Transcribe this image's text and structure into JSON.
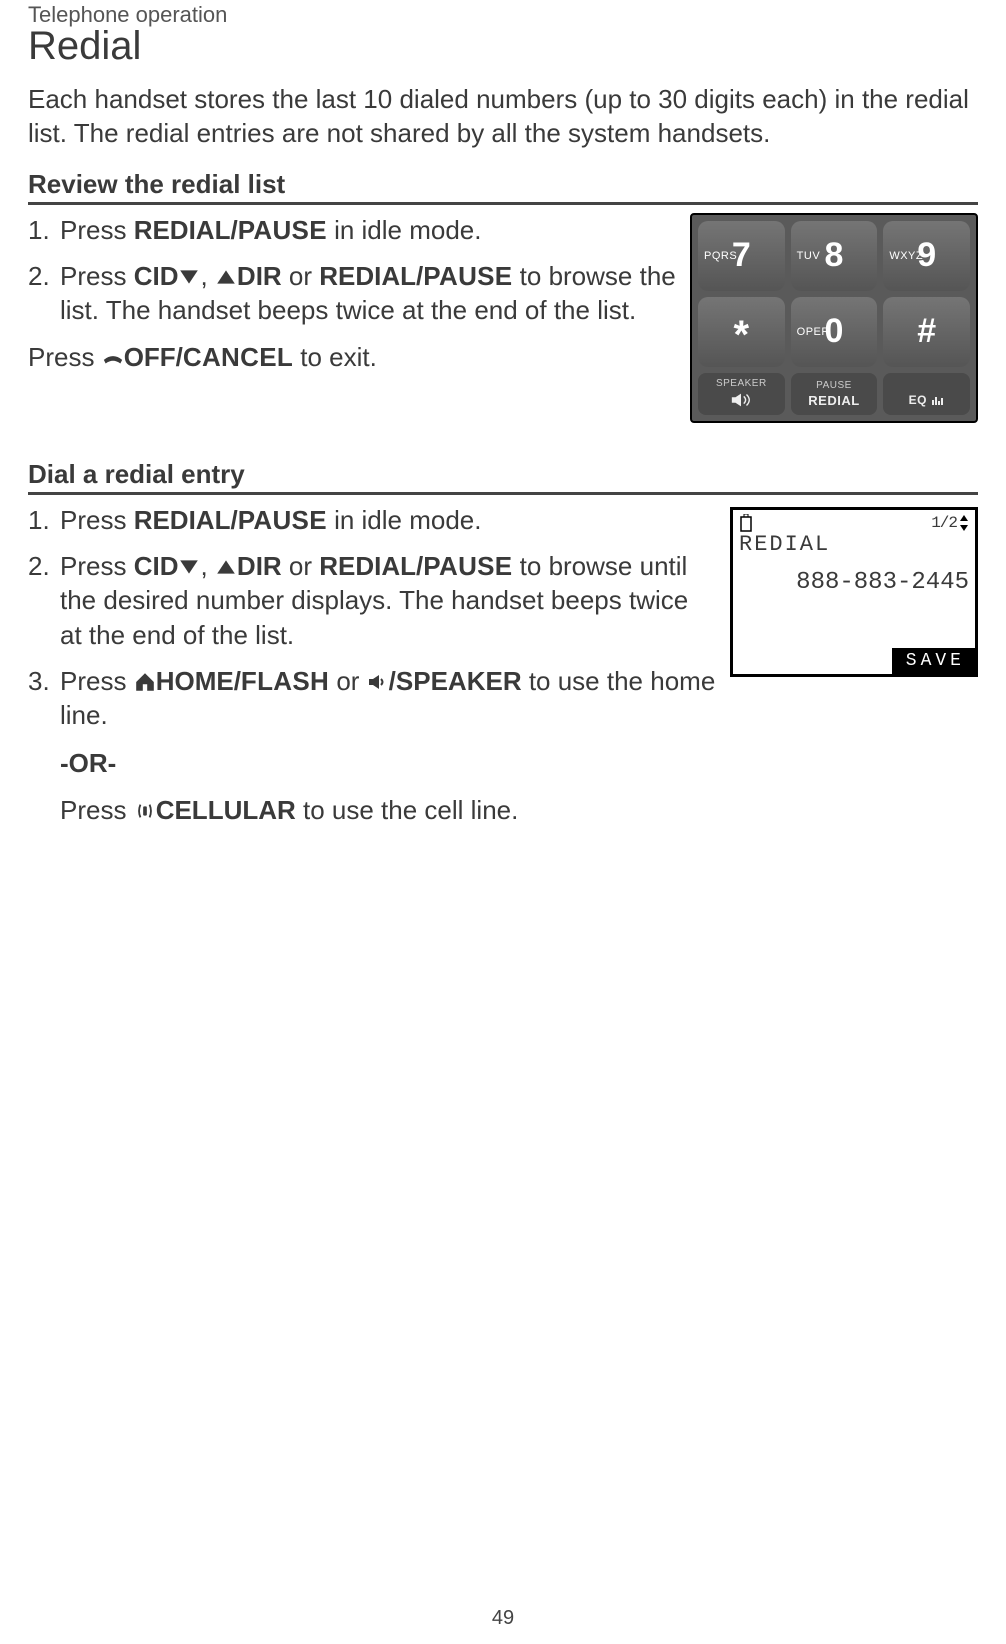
{
  "chapter": "Telephone operation",
  "title": "Redial",
  "intro": "Each handset stores the last 10 dialed numbers (up to 30 digits each) in the redial list. The redial entries are not shared by all the system handsets.",
  "section1": {
    "heading": "Review the redial list",
    "step1_a": "Press ",
    "step1_b_bold": "REDIAL/",
    "step1_b_sc": "PAUSE",
    "step1_c": " in idle mode.",
    "step2_a": "Press ",
    "step2_cid": "CID",
    "step2_comma": ", ",
    "step2_dir": "DIR",
    "step2_or": " or ",
    "step2_red_bold": "REDIAL/",
    "step2_red_sc": "PAUSE",
    "step2_b": " to browse the list. The handset beeps twice at the end of the list.",
    "exit_a": "Press ",
    "exit_off": "OFF/",
    "exit_cancel": "CANCEL",
    "exit_b": " to exit."
  },
  "section2": {
    "heading": "Dial a redial entry",
    "step1_a": "Press ",
    "step1_b_bold": "REDIAL/",
    "step1_b_sc": "PAUSE",
    "step1_c": " in idle mode.",
    "step2_a": "Press ",
    "step2_cid": "CID",
    "step2_comma": ", ",
    "step2_dir": "DIR",
    "step2_or": " or ",
    "step2_red_bold": "REDIAL/",
    "step2_red_sc": "PAUSE",
    "step2_b": " to browse until the desired number displays. The handset beeps twice at the end of the list.",
    "step3_a": "Press ",
    "step3_home": "HOME/",
    "step3_flash": "FLASH",
    "step3_or": " or ",
    "step3_spk": "/SPEAKER",
    "step3_b": " to use the home line.",
    "or": "-OR-",
    "step3c_a": "Press ",
    "step3c_cell": "CELLULAR",
    "step3c_b": " to use the cell line."
  },
  "keypad": {
    "k7_let": "PQRS",
    "k7_num": "7",
    "k8_let": "TUV",
    "k8_num": "8",
    "k9_let": "WXYZ",
    "k9_num": "9",
    "star": "*",
    "k0_let": "OPER",
    "k0_num": "0",
    "pound": "#",
    "r1_top": "SPEAKER",
    "r2_top": "PAUSE",
    "r2_bot": "REDIAL",
    "r3_bot": "EQ"
  },
  "lcd": {
    "count": "1/2",
    "line1": "REDIAL",
    "line2": "888-883-2445",
    "save": "SAVE"
  },
  "page": "49"
}
